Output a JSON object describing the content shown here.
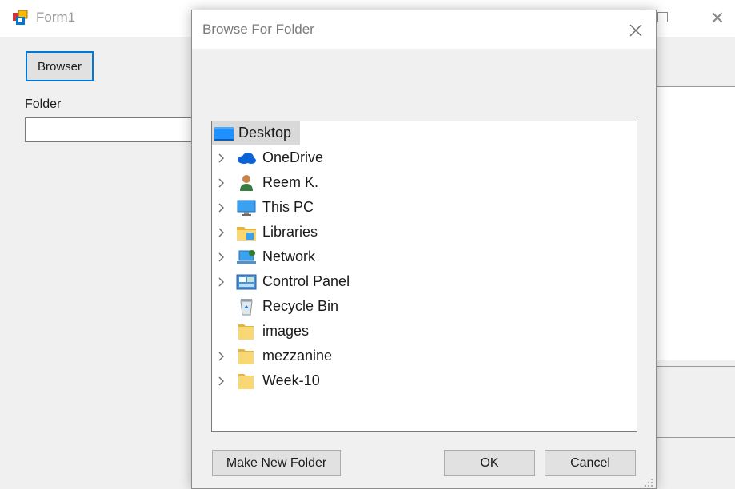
{
  "form1": {
    "title": "Form1",
    "browser_button_label": "Browser",
    "folder_label": "Folder",
    "folder_value": ""
  },
  "dialog": {
    "title": "Browse For Folder",
    "tree": [
      {
        "label": "Desktop",
        "icon": "desktop-icon",
        "expandable": false,
        "selected": true
      },
      {
        "label": "OneDrive",
        "icon": "onedrive-cloud-icon",
        "expandable": true
      },
      {
        "label": "Reem K.",
        "icon": "user-icon",
        "expandable": true
      },
      {
        "label": "This PC",
        "icon": "this-pc-monitor-icon",
        "expandable": true
      },
      {
        "label": "Libraries",
        "icon": "libraries-folder-icon",
        "expandable": true
      },
      {
        "label": "Network",
        "icon": "network-icon",
        "expandable": true
      },
      {
        "label": "Control Panel",
        "icon": "control-panel-icon",
        "expandable": true
      },
      {
        "label": "Recycle Bin",
        "icon": "recycle-bin-icon",
        "expandable": false
      },
      {
        "label": "images",
        "icon": "folder-icon",
        "expandable": false
      },
      {
        "label": "mezzanine",
        "icon": "folder-icon",
        "expandable": true
      },
      {
        "label": "Week-10",
        "icon": "folder-icon",
        "expandable": true
      }
    ],
    "buttons": {
      "make_new_folder": "Make New Folder",
      "ok": "OK",
      "cancel": "Cancel"
    }
  },
  "colors": {
    "accent": "#0078d7",
    "selection": "#d9d9d9",
    "folder": "#f8d775"
  }
}
